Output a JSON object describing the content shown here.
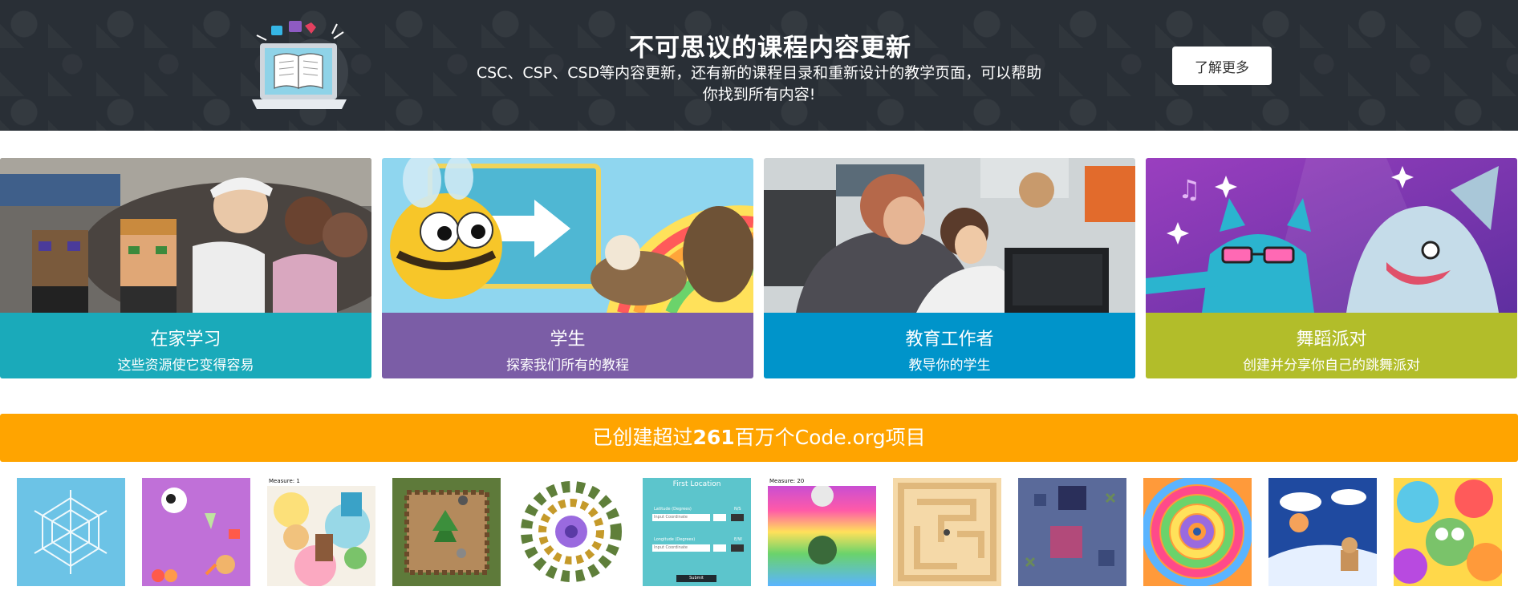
{
  "banner": {
    "title": "不可思议的课程内容更新",
    "description_line1": "CSC、CSP、CSD等内容更新，还有新的课程目录和重新设计的教学页面，可以帮助",
    "description_line2": "你找到所有内容!",
    "learn_more_label": "了解更多",
    "background_color": "#292f36"
  },
  "tiles": [
    {
      "title": "在家学习",
      "subtitle": "这些资源使它变得容易",
      "color": "#1aaaba"
    },
    {
      "title": "学生",
      "subtitle": "探索我们所有的教程",
      "color": "#7b5da6"
    },
    {
      "title": "教育工作者",
      "subtitle": "教导你的学生",
      "color": "#0094ca"
    },
    {
      "title": "舞蹈派对",
      "subtitle": "创建并分享你自己的跳舞派对",
      "color": "#b2bd2a"
    }
  ],
  "projects": {
    "prefix": "已创建超过",
    "count": "261",
    "suffix": "百万个Code.org项目",
    "bar_color": "#ffa400"
  },
  "thumbnails": {
    "measure_label_1": "Measure: 1",
    "measure_label_2": "Measure: 20",
    "first_location_title": "First Location",
    "latitude_label": "Latitude (Degrees)",
    "longitude_label": "Longitude (Degrees)",
    "input_placeholder": "Input Coordinate",
    "ns_label": "N/S",
    "ew_label": "E/W",
    "submit_label": "Submit"
  }
}
